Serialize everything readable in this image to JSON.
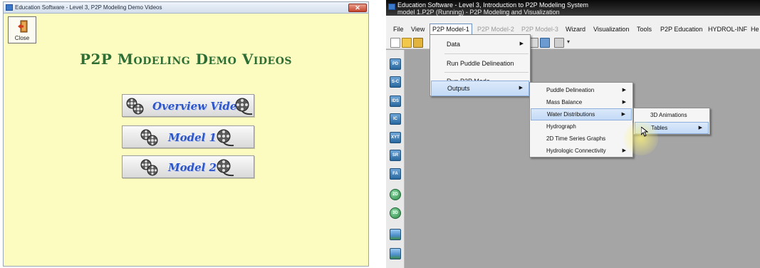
{
  "left_window": {
    "title": "Education Software - Level 3, P2P Modeling Demo Videos",
    "close_label": "Close",
    "heading": "P2P Modeling Demo Videos",
    "buttons": [
      {
        "label": "Overview Video"
      },
      {
        "label": "Model 1"
      },
      {
        "label": "Model 2"
      }
    ]
  },
  "right_window": {
    "title": "Education Software - Level 3, Introduction to P2P Modeling System",
    "subtitle": "model 1.P2P (Running) - P2P Modeling and Visualization",
    "menubar": [
      "File",
      "View",
      "P2P Model-1",
      "P2P Model-2",
      "P2P Model-3",
      "Wizard",
      "Visualization",
      "Tools",
      "P2P Education",
      "HYDROL-INF",
      "He"
    ],
    "p2p_menu": [
      "Data",
      "Run Puddle Delineation",
      "Run P2P Mode",
      "Outputs"
    ],
    "outputs_menu": [
      "Puddle Delineation",
      "Mass Balance",
      "Water Distributions",
      "Hydrograph",
      "2D Time Series Graphs",
      "Hydrologic Connectivity"
    ],
    "water_menu": [
      "3D Animations",
      "Tables"
    ],
    "sidebar_icons": [
      "PD",
      "S-C",
      "IDS",
      "IC",
      "XYT",
      "SR",
      "FA",
      "2D",
      "3D"
    ]
  },
  "colors": {
    "left_bg": "#fdfcc0",
    "heading": "#2d6e35",
    "button_text": "#2b55c9",
    "right_bg": "#a5a5a5",
    "highlight": "#c3daf6"
  }
}
